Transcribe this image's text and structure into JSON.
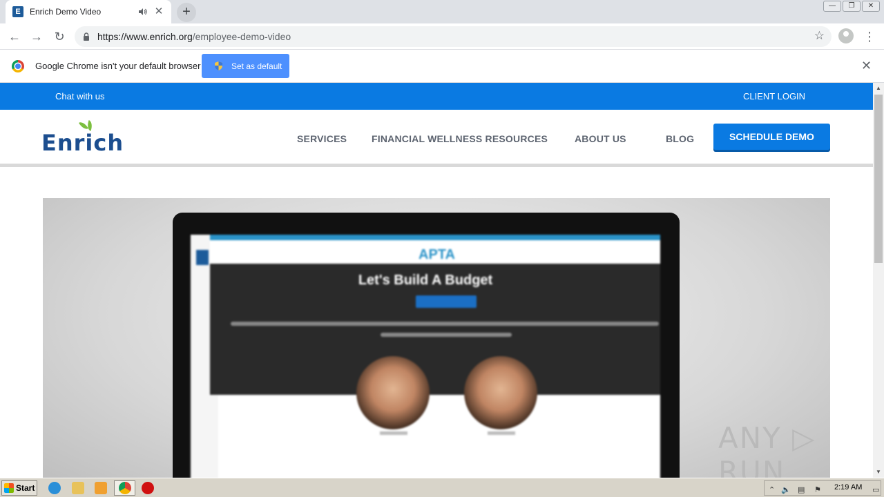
{
  "browser": {
    "tab_title": "Enrich Demo Video",
    "tab_favicon_letter": "E",
    "newtab_label": "+",
    "url_host": "https://www.enrich.org",
    "url_path": "/employee-demo-video",
    "window_controls": [
      "—",
      "❐",
      "✕"
    ]
  },
  "infobar": {
    "message": "Google Chrome isn't your default browser",
    "button_label": "Set as default"
  },
  "site": {
    "top_links": {
      "chat": "Chat with us",
      "login": "CLIENT LOGIN"
    },
    "logo_text": "Enrich",
    "nav": [
      "SERVICES",
      "FINANCIAL WELLNESS RESOURCES",
      "ABOUT US",
      "BLOG"
    ],
    "cta": "SCHEDULE DEMO"
  },
  "video": {
    "screen_brand": "APTA",
    "screen_title": "Let's Build A Budget"
  },
  "watermark": "ANY ▷ RUN",
  "taskbar": {
    "start_label": "Start",
    "clock": "2:19 AM"
  },
  "colors": {
    "brand_blue": "#0a7ae2",
    "logo_navy": "#1c4e8f",
    "logo_green": "#7cbf3f"
  }
}
